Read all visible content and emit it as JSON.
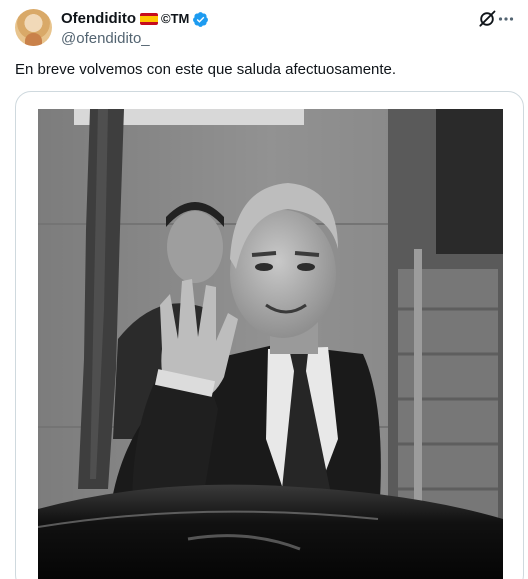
{
  "author": {
    "display_name": "Ofendidito",
    "name_suffix": "©TM",
    "handle": "@ofendidito_",
    "flag_icon": "spain-flag-icon",
    "verified_icon": "verified-badge-icon",
    "verified_color": "#1d9bf0"
  },
  "tweet": {
    "text": "En breve volvemos con este que saluda afectuosamente."
  },
  "actions": {
    "grok_icon": "grok-icon",
    "more_icon": "more-options-icon"
  },
  "media": {
    "kind": "black-and-white photograph"
  },
  "colors": {
    "text": "#0f1419",
    "secondary_text": "#536471",
    "card_border": "#cfd9de",
    "accent": "#1d9bf0"
  }
}
